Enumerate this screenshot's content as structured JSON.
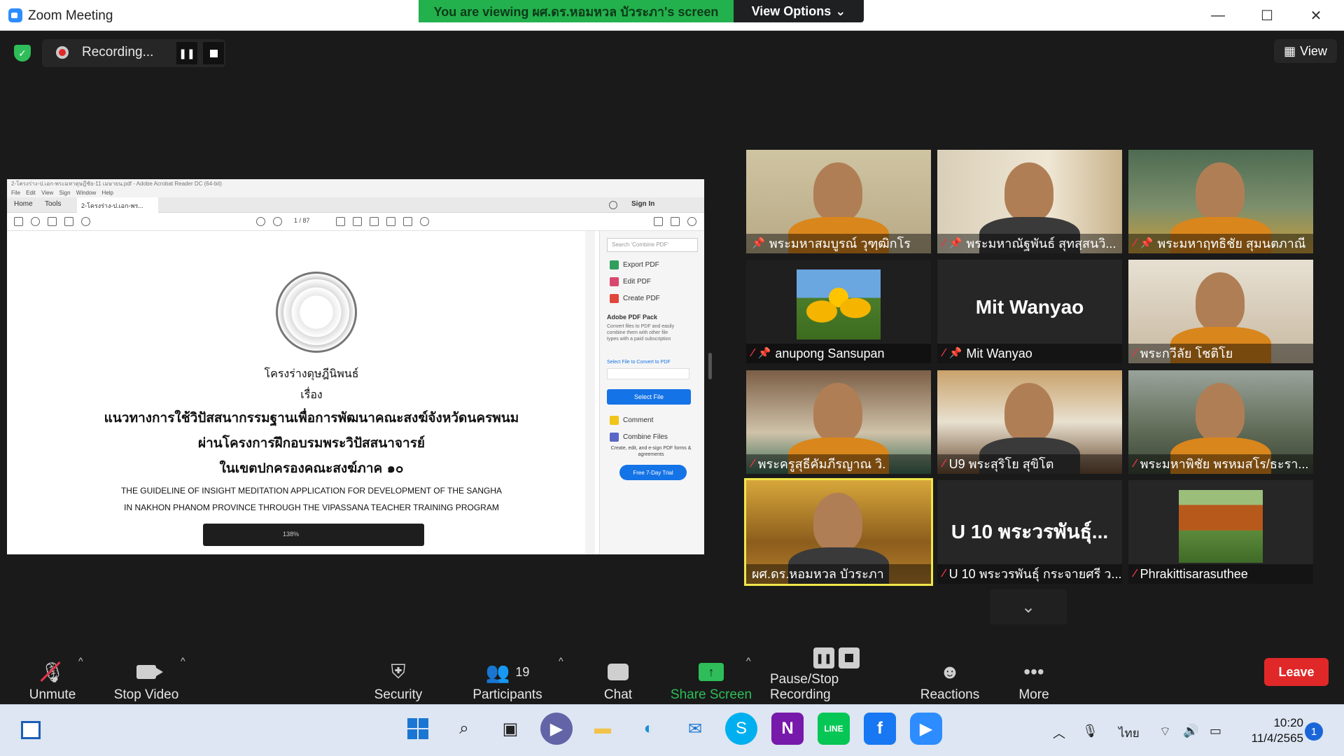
{
  "window": {
    "title": "Zoom Meeting",
    "viewing_banner": "You are viewing ผศ.ดร.หอมหวล บัวระภา's screen",
    "view_options": "View Options",
    "minimize": "—",
    "maximize": "☐",
    "close": "✕"
  },
  "meeting": {
    "recording_label": "Recording...",
    "view_label": "View"
  },
  "acrobat": {
    "title": "2-โครงร่าง-ป.เอก-พระมหาดุษฎีชัย-11 เมษายน.pdf - Adobe Acrobat Reader DC (64-bit)",
    "menu": "File  Edit  View  Sign  Window  Help",
    "tab_home": "Home",
    "tab_tools": "Tools",
    "doc_tab": "2-โครงร่าง-ป.เอก-พร...",
    "sign_in": "Sign In",
    "page_indicator": "1  / 87",
    "zoom": "138%",
    "doc": {
      "line1": "โครงร่างดุษฎีนิพนธ์",
      "line2": "เรื่อง",
      "line3": "แนวทางการใช้วิปัสสนากรรมฐานเพื่อการพัฒนาคณะสงฆ์จังหวัดนครพนม",
      "line4": "ผ่านโครงการฝึกอบรมพระวิปัสสนาจารย์",
      "line5": "ในเขตปกครองคณะสงฆ์ภาค ๑๐",
      "line6": "THE GUIDELINE OF INSIGHT MEDITATION APPLICATION FOR DEVELOPMENT  OF THE  SANGHA",
      "line7": "IN NAKHON PHANOM PROVINCE THROUGH THE VIPASSANA TEACHER TRAINING PROGRAM"
    },
    "right_pane": {
      "search_placeholder": "Search 'Combine PDF'",
      "export_pdf": "Export PDF",
      "edit_pdf": "Edit PDF",
      "create_pdf": "Create PDF",
      "pack_title": "Adobe PDF Pack",
      "pack_desc": "Convert files to PDF and easily combine them with other file types with a paid subscription",
      "select_label": "Select File to Convert to PDF",
      "select_button": "Select File",
      "comment": "Comment",
      "combine": "Combine Files",
      "promo": "Create, edit, and e-sign PDF forms & agreements",
      "trial": "Free 7-Day Trial"
    }
  },
  "participants": [
    {
      "name": "พระมหาสมบูรณ์ วุฑฺฒิกโร",
      "muted": false,
      "pinned": true
    },
    {
      "name": "พระมหาณัฐพันธ์ สุทสฺสนวิ...",
      "muted": true,
      "pinned": true
    },
    {
      "name": "พระมหาฤทธิชัย สุมนตภาณี",
      "muted": true,
      "pinned": true
    },
    {
      "name": "anupong Sansupan",
      "muted": true,
      "pinned": true
    },
    {
      "name": "Mit Wanyao",
      "muted": true,
      "pinned": true,
      "display": "Mit Wanyao"
    },
    {
      "name": "พระกวีลัย โชติโย",
      "muted": true,
      "pinned": false
    },
    {
      "name": "พระครูสุธีคัมภีรญาณ วิ.",
      "muted": true,
      "pinned": false
    },
    {
      "name": "U9 พระสุริโย สุขิโต",
      "muted": true,
      "pinned": false
    },
    {
      "name": "พระมหาพิชัย  พรหมสโร/ธะรา...",
      "muted": true,
      "pinned": false
    },
    {
      "name": "ผศ.ดร.หอมหวล บัวระภา",
      "muted": false,
      "pinned": false
    },
    {
      "name": "U 10 พระวรพันธุ์ กระจายศรี ว...",
      "muted": true,
      "pinned": false,
      "display": "U 10 พระวรพันธุ์..."
    },
    {
      "name": "Phrakittisarasuthee",
      "muted": true,
      "pinned": false
    }
  ],
  "controls": {
    "unmute": "Unmute",
    "stop_video": "Stop Video",
    "security": "Security",
    "participants": "Participants",
    "participants_count": "19",
    "chat": "Chat",
    "share_screen": "Share Screen",
    "pause_stop_recording": "Pause/Stop Recording",
    "reactions": "Reactions",
    "more": "More",
    "leave": "Leave"
  },
  "taskbar": {
    "language": "ไทย",
    "time": "10:20",
    "date": "11/4/2565",
    "notifications": "1"
  },
  "colors": {
    "share_green": "#23b14d",
    "leave_red": "#e02828",
    "active_speaker": "#f0e64a",
    "zoom_blue": "#2d8cff"
  }
}
